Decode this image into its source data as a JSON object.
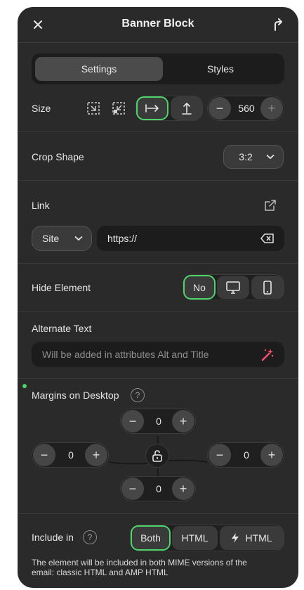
{
  "header": {
    "title": "Banner Block",
    "close_icon": "close-icon",
    "share_icon": "share-icon"
  },
  "tabs": [
    {
      "label": "Settings",
      "active": true
    },
    {
      "label": "Styles",
      "active": false
    }
  ],
  "size": {
    "label": "Size",
    "value": "560",
    "minus": "−",
    "plus": "+"
  },
  "crop": {
    "label": "Crop Shape",
    "value": "3:2"
  },
  "link": {
    "label": "Link",
    "type": "Site",
    "placeholder": "https://"
  },
  "hide": {
    "label": "Hide Element",
    "no_label": "No"
  },
  "alt": {
    "label": "Alternate Text",
    "placeholder": "Will be added in attributes Alt and Title"
  },
  "margins": {
    "label": "Margins on Desktop",
    "help": "?",
    "top": "0",
    "left": "0",
    "right": "0",
    "bottom": "0",
    "minus": "−",
    "plus": "+"
  },
  "include": {
    "label": "Include in",
    "help": "?",
    "options": [
      "Both",
      "HTML",
      "HTML"
    ],
    "note_line1": "The element will be included in both MIME versions of the",
    "note_line2": "email: classic HTML and AMP HTML"
  },
  "colors": {
    "accent": "#4cd46a",
    "panel": "#2a2a2a"
  }
}
